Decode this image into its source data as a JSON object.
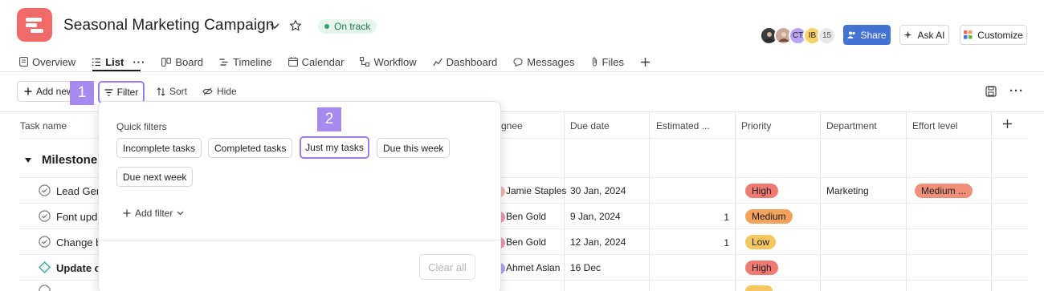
{
  "project": {
    "title": "Seasonal Marketing Campaign",
    "status": "On track",
    "brand_color": "#f06a6a"
  },
  "header": {
    "avatars": [
      {
        "initials": "",
        "color": "#3b3b3b",
        "icon": "person-photo"
      },
      {
        "initials": "",
        "color": "#8a6a5a",
        "icon": "person-photo"
      },
      {
        "initials": "CT",
        "color": "#b9a4f2"
      },
      {
        "initials": "IB",
        "color": "#f5d36a"
      }
    ],
    "member_count": "15",
    "share_label": "Share",
    "ask_ai_label": "Ask AI",
    "customize_label": "Customize"
  },
  "tabs": [
    {
      "label": "Overview",
      "icon": "overview-icon"
    },
    {
      "label": "List",
      "icon": "list-icon",
      "active": true
    },
    {
      "label": "Board",
      "icon": "board-icon"
    },
    {
      "label": "Timeline",
      "icon": "timeline-icon"
    },
    {
      "label": "Calendar",
      "icon": "calendar-icon"
    },
    {
      "label": "Workflow",
      "icon": "workflow-icon"
    },
    {
      "label": "Dashboard",
      "icon": "dashboard-icon"
    },
    {
      "label": "Messages",
      "icon": "messages-icon"
    },
    {
      "label": "Files",
      "icon": "files-icon"
    }
  ],
  "toolbar": {
    "add_new_label": "Add new",
    "filter_label": "Filter",
    "sort_label": "Sort",
    "hide_label": "Hide"
  },
  "markers": {
    "one": "1",
    "two": "2"
  },
  "table": {
    "columns": {
      "task_name": "Task name",
      "assignee": "gnee",
      "due_date": "Due date",
      "estimated": "Estimated ...",
      "priority": "Priority",
      "department": "Department",
      "effort": "Effort level"
    },
    "section": "Milestone",
    "rows": [
      {
        "name": "Lead Gen",
        "assignee": "Jamie Staples",
        "due": "30 Jan, 2024",
        "estimate": "",
        "priority": "High",
        "department": "Marketing",
        "effort": "Medium ..."
      },
      {
        "name": "Font upd",
        "assignee": "Ben Gold",
        "due": "9 Jan, 2024",
        "estimate": "1",
        "priority": "Medium",
        "department": "",
        "effort": ""
      },
      {
        "name": "Change b",
        "assignee": "Ben Gold",
        "due": "12 Jan, 2024",
        "estimate": "1",
        "priority": "Low",
        "department": "",
        "effort": ""
      },
      {
        "name": "Update c",
        "assignee": "Ahmet Aslan",
        "due": "16 Dec",
        "estimate": "",
        "priority": "High",
        "department": "",
        "effort": ""
      }
    ]
  },
  "priority_colors": {
    "High": "#f07b72",
    "Medium": "#f5a35c",
    "Low": "#f4c761"
  },
  "filter_dropdown": {
    "quick_filters_title": "Quick filters",
    "chips": [
      "Incomplete tasks",
      "Completed tasks",
      "Just my tasks",
      "Due this week",
      "Due next week"
    ],
    "selected_chip": "Just my tasks",
    "add_filter_label": "Add filter",
    "clear_all_label": "Clear all"
  }
}
